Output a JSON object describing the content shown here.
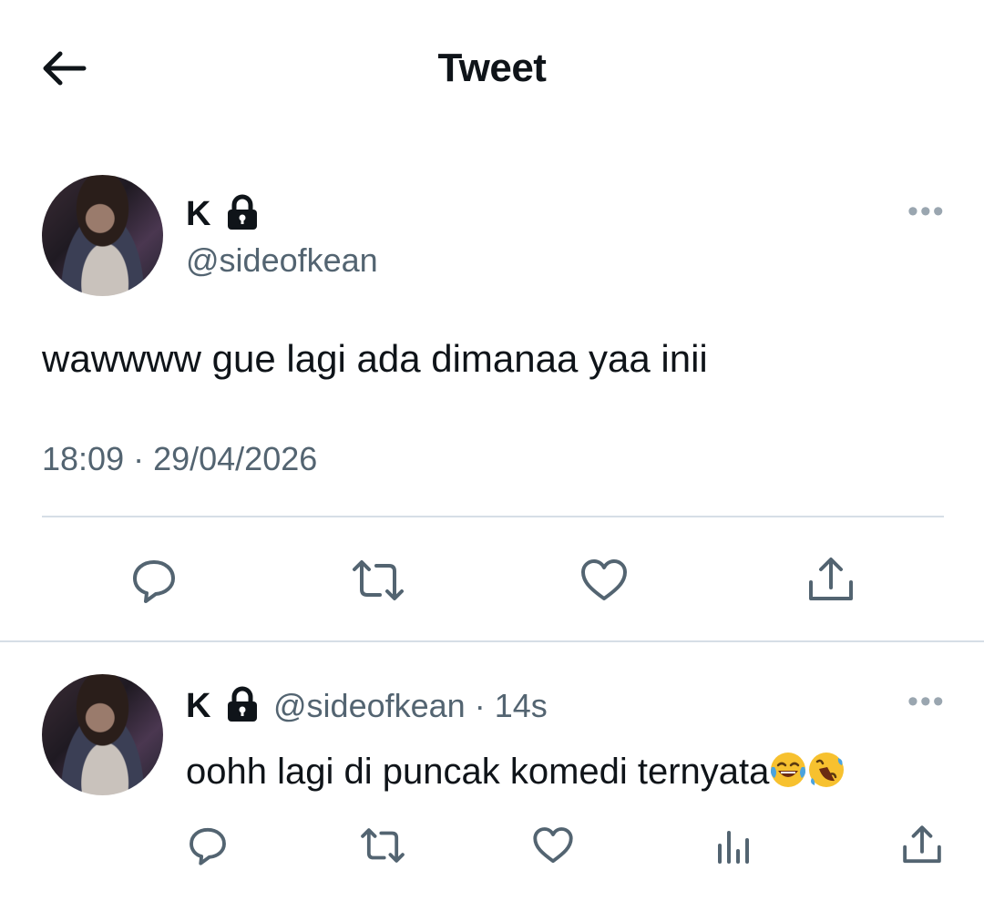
{
  "header": {
    "title": "Tweet",
    "back_icon": "arrow-left-icon"
  },
  "tweet": {
    "display_name": "K",
    "protected_icon": "lock-icon",
    "handle": "@sideofkean",
    "text": "wawwww gue lagi ada dimanaa yaa inii",
    "timestamp": "18:09 · 29/04/2026",
    "more_icon": "more-horizontal-icon",
    "more_label": "•••",
    "actions": [
      "reply-icon",
      "retweet-icon",
      "like-icon",
      "share-icon"
    ]
  },
  "reply": {
    "display_name": "K",
    "protected_icon": "lock-icon",
    "handle": "@sideofkean",
    "separator": "·",
    "time": "14s",
    "text": "oohh lagi di puncak komedi ternyata",
    "emojis": [
      "face-with-tears-of-joy-emoji",
      "rolling-on-the-floor-laughing-emoji"
    ],
    "more_label": "•••",
    "actions": [
      "reply-icon",
      "retweet-icon",
      "like-icon",
      "analytics-icon",
      "share-icon"
    ]
  },
  "colors": {
    "text_primary": "#0f1419",
    "text_secondary": "#536471",
    "divider": "#d6dee6",
    "icon": "#536471"
  }
}
